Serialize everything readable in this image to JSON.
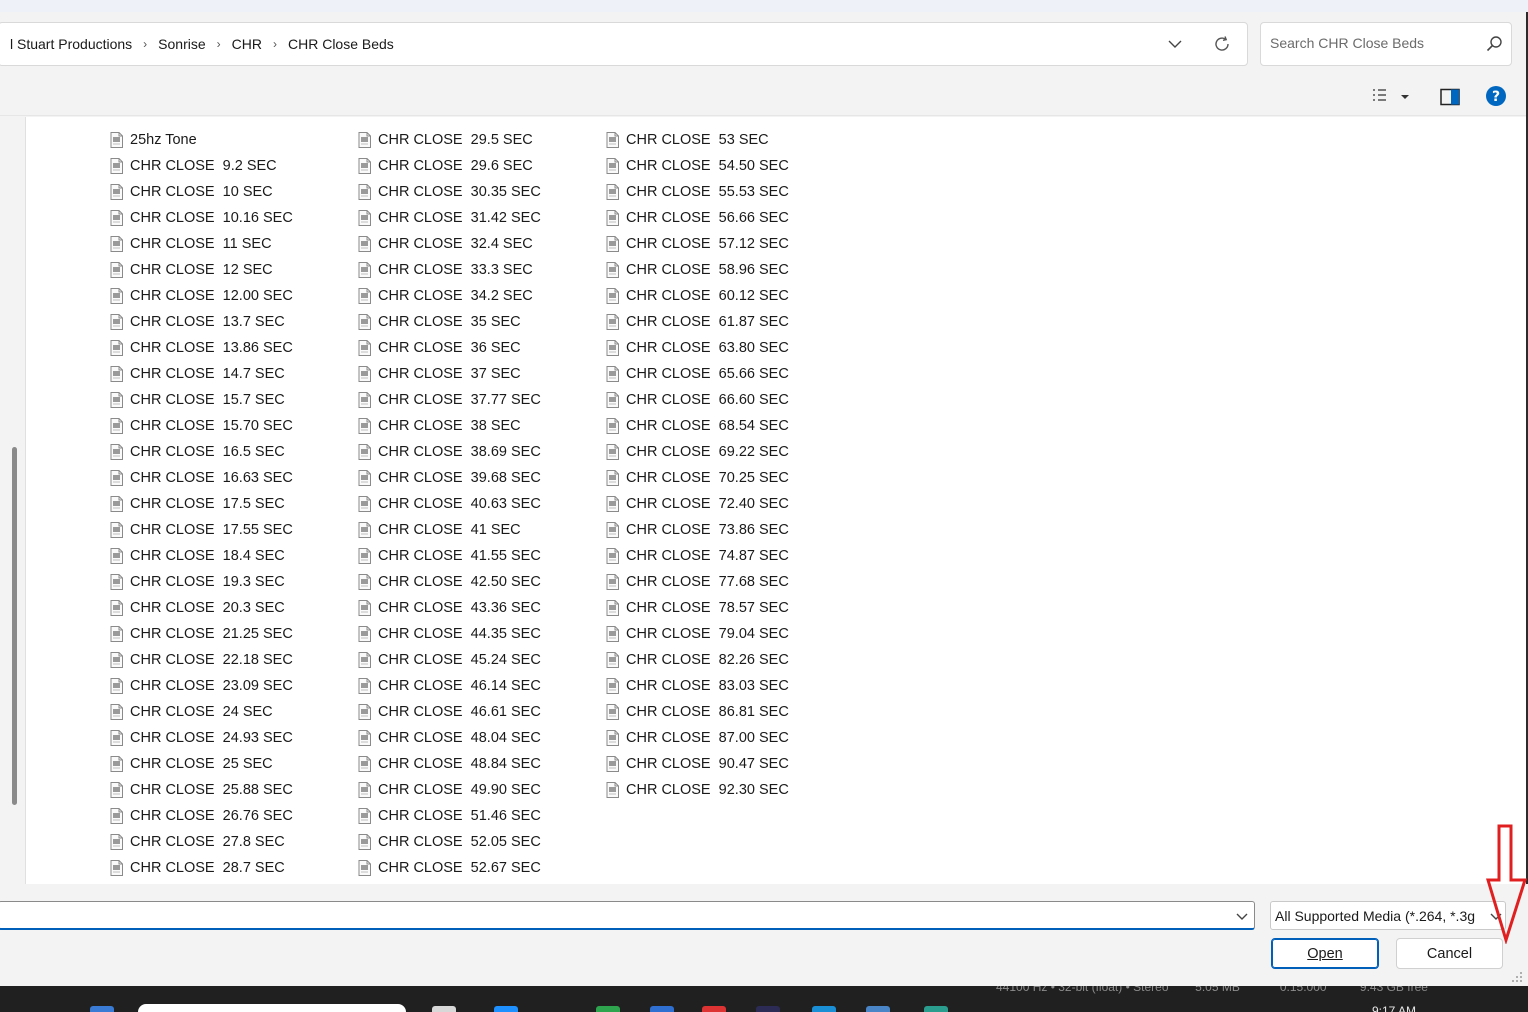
{
  "address": {
    "breadcrumbs": [
      "l Stuart Productions",
      "Sonrise",
      "CHR",
      "CHR Close Beds"
    ],
    "search_placeholder": "Search CHR Close Beds"
  },
  "icons": {
    "file": "audio-file-icon",
    "refresh": "refresh-icon",
    "search": "search-icon",
    "view": "details-view-icon",
    "preview": "preview-pane-icon",
    "help": "help-icon"
  },
  "colors": {
    "accent": "#005fb8",
    "help": "#0067c0",
    "arrow": "#e02020"
  },
  "files": {
    "col1": [
      "25hz Tone",
      "CHR CLOSE  9.2 SEC",
      "CHR CLOSE  10 SEC",
      "CHR CLOSE  10.16 SEC",
      "CHR CLOSE  11 SEC",
      "CHR CLOSE  12 SEC",
      "CHR CLOSE  12.00 SEC",
      "CHR CLOSE  13.7 SEC",
      "CHR CLOSE  13.86 SEC",
      "CHR CLOSE  14.7 SEC",
      "CHR CLOSE  15.7 SEC",
      "CHR CLOSE  15.70 SEC",
      "CHR CLOSE  16.5 SEC",
      "CHR CLOSE  16.63 SEC",
      "CHR CLOSE  17.5 SEC",
      "CHR CLOSE  17.55 SEC",
      "CHR CLOSE  18.4 SEC",
      "CHR CLOSE  19.3 SEC",
      "CHR CLOSE  20.3 SEC",
      "CHR CLOSE  21.25 SEC",
      "CHR CLOSE  22.18 SEC",
      "CHR CLOSE  23.09 SEC",
      "CHR CLOSE  24 SEC",
      "CHR CLOSE  24.93 SEC",
      "CHR CLOSE  25 SEC",
      "CHR CLOSE  25.88 SEC",
      "CHR CLOSE  26.76 SEC",
      "CHR CLOSE  27.8 SEC",
      "CHR CLOSE  28.7 SEC"
    ],
    "col2": [
      "CHR CLOSE  29.5 SEC",
      "CHR CLOSE  29.6 SEC",
      "CHR CLOSE  30.35 SEC",
      "CHR CLOSE  31.42 SEC",
      "CHR CLOSE  32.4 SEC",
      "CHR CLOSE  33.3 SEC",
      "CHR CLOSE  34.2 SEC",
      "CHR CLOSE  35 SEC",
      "CHR CLOSE  36 SEC",
      "CHR CLOSE  37 SEC",
      "CHR CLOSE  37.77 SEC",
      "CHR CLOSE  38 SEC",
      "CHR CLOSE  38.69 SEC",
      "CHR CLOSE  39.68 SEC",
      "CHR CLOSE  40.63 SEC",
      "CHR CLOSE  41 SEC",
      "CHR CLOSE  41.55 SEC",
      "CHR CLOSE  42.50 SEC",
      "CHR CLOSE  43.36 SEC",
      "CHR CLOSE  44.35 SEC",
      "CHR CLOSE  45.24 SEC",
      "CHR CLOSE  46.14 SEC",
      "CHR CLOSE  46.61 SEC",
      "CHR CLOSE  48.04 SEC",
      "CHR CLOSE  48.84 SEC",
      "CHR CLOSE  49.90 SEC",
      "CHR CLOSE  51.46 SEC",
      "CHR CLOSE  52.05 SEC",
      "CHR CLOSE  52.67 SEC"
    ],
    "col3": [
      "CHR CLOSE  53 SEC",
      "CHR CLOSE  54.50 SEC",
      "CHR CLOSE  55.53 SEC",
      "CHR CLOSE  56.66 SEC",
      "CHR CLOSE  57.12 SEC",
      "CHR CLOSE  58.96 SEC",
      "CHR CLOSE  60.12 SEC",
      "CHR CLOSE  61.87 SEC",
      "CHR CLOSE  63.80 SEC",
      "CHR CLOSE  65.66 SEC",
      "CHR CLOSE  66.60 SEC",
      "CHR CLOSE  68.54 SEC",
      "CHR CLOSE  69.22 SEC",
      "CHR CLOSE  70.25 SEC",
      "CHR CLOSE  72.40 SEC",
      "CHR CLOSE  73.86 SEC",
      "CHR CLOSE  74.87 SEC",
      "CHR CLOSE  77.68 SEC",
      "CHR CLOSE  78.57 SEC",
      "CHR CLOSE  79.04 SEC",
      "CHR CLOSE  82.26 SEC",
      "CHR CLOSE  83.03 SEC",
      "CHR CLOSE  86.81 SEC",
      "CHR CLOSE  87.00 SEC",
      "CHR CLOSE  90.47 SEC",
      "CHR CLOSE  92.30 SEC"
    ]
  },
  "footer": {
    "filename_value": "",
    "filetype_selected": "All Supported Media (*.264, *.3g",
    "open_label": "Open",
    "cancel_label": "Cancel"
  },
  "taskbar": {
    "status_text": "44100 Hz • 32-bit (float) • Stereo        5.05 MB            0:15.000          9.43 GB free",
    "clock": "9:17 AM"
  }
}
